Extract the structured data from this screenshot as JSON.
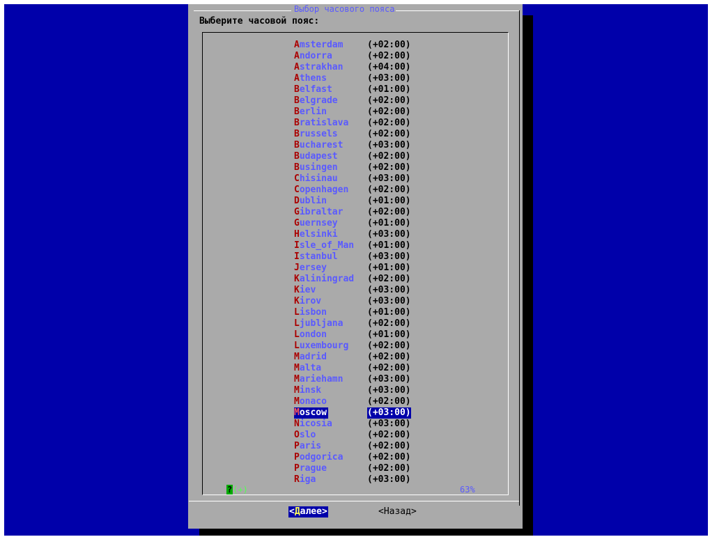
{
  "dialog": {
    "title": "Выбор часового пояса",
    "prompt": "Выберите часовой пояс:"
  },
  "timezones": [
    {
      "hotkey": "A",
      "rest": "msterdam",
      "offset": "(+02:00)"
    },
    {
      "hotkey": "A",
      "rest": "ndorra",
      "offset": "(+02:00)"
    },
    {
      "hotkey": "A",
      "rest": "strakhan",
      "offset": "(+04:00)"
    },
    {
      "hotkey": "A",
      "rest": "thens",
      "offset": "(+03:00)"
    },
    {
      "hotkey": "B",
      "rest": "elfast",
      "offset": "(+01:00)"
    },
    {
      "hotkey": "B",
      "rest": "elgrade",
      "offset": "(+02:00)"
    },
    {
      "hotkey": "B",
      "rest": "erlin",
      "offset": "(+02:00)"
    },
    {
      "hotkey": "B",
      "rest": "ratislava",
      "offset": "(+02:00)"
    },
    {
      "hotkey": "B",
      "rest": "russels",
      "offset": "(+02:00)"
    },
    {
      "hotkey": "B",
      "rest": "ucharest",
      "offset": "(+03:00)"
    },
    {
      "hotkey": "B",
      "rest": "udapest",
      "offset": "(+02:00)"
    },
    {
      "hotkey": "B",
      "rest": "usingen",
      "offset": "(+02:00)"
    },
    {
      "hotkey": "C",
      "rest": "hisinau",
      "offset": "(+03:00)"
    },
    {
      "hotkey": "C",
      "rest": "openhagen",
      "offset": "(+02:00)"
    },
    {
      "hotkey": "D",
      "rest": "ublin",
      "offset": "(+01:00)"
    },
    {
      "hotkey": "G",
      "rest": "ibraltar",
      "offset": "(+02:00)"
    },
    {
      "hotkey": "G",
      "rest": "uernsey",
      "offset": "(+01:00)"
    },
    {
      "hotkey": "H",
      "rest": "elsinki",
      "offset": "(+03:00)"
    },
    {
      "hotkey": "I",
      "rest": "sle_of_Man",
      "offset": "(+01:00)"
    },
    {
      "hotkey": "I",
      "rest": "stanbul",
      "offset": "(+03:00)"
    },
    {
      "hotkey": "J",
      "rest": "ersey",
      "offset": "(+01:00)"
    },
    {
      "hotkey": "K",
      "rest": "aliningrad",
      "offset": "(+02:00)"
    },
    {
      "hotkey": "K",
      "rest": "iev",
      "offset": "(+03:00)"
    },
    {
      "hotkey": "K",
      "rest": "irov",
      "offset": "(+03:00)"
    },
    {
      "hotkey": "L",
      "rest": "isbon",
      "offset": "(+01:00)"
    },
    {
      "hotkey": "L",
      "rest": "jubljana",
      "offset": "(+02:00)"
    },
    {
      "hotkey": "L",
      "rest": "ondon",
      "offset": "(+01:00)"
    },
    {
      "hotkey": "L",
      "rest": "uxembourg",
      "offset": "(+02:00)"
    },
    {
      "hotkey": "M",
      "rest": "adrid",
      "offset": "(+02:00)"
    },
    {
      "hotkey": "M",
      "rest": "alta",
      "offset": "(+02:00)"
    },
    {
      "hotkey": "M",
      "rest": "ariehamn",
      "offset": "(+03:00)"
    },
    {
      "hotkey": "M",
      "rest": "insk",
      "offset": "(+03:00)"
    },
    {
      "hotkey": "M",
      "rest": "onaco",
      "offset": "(+02:00)"
    },
    {
      "hotkey": "M",
      "rest": "oscow",
      "offset": "(+03:00)",
      "selected": true
    },
    {
      "hotkey": "N",
      "rest": "icosia",
      "offset": "(+03:00)"
    },
    {
      "hotkey": "O",
      "rest": "slo",
      "offset": "(+02:00)"
    },
    {
      "hotkey": "P",
      "rest": "aris",
      "offset": "(+02:00)"
    },
    {
      "hotkey": "P",
      "rest": "odgorica",
      "offset": "(+02:00)"
    },
    {
      "hotkey": "P",
      "rest": "rague",
      "offset": "(+02:00)"
    },
    {
      "hotkey": "R",
      "rest": "iga",
      "offset": "(+03:00)"
    }
  ],
  "scroll": {
    "help": "?",
    "arrows": "(+)",
    "percent": "63%"
  },
  "buttons": {
    "next": {
      "open": "<",
      "hotkey": "Д",
      "rest": "алее",
      "close": ">"
    },
    "back": "<Назад>"
  },
  "colors": {
    "background": "#0000aa",
    "dialog": "#aaaaaa",
    "item_text": "#5a5aff",
    "hotkey": "#aa0000",
    "selection": "#0000aa"
  }
}
